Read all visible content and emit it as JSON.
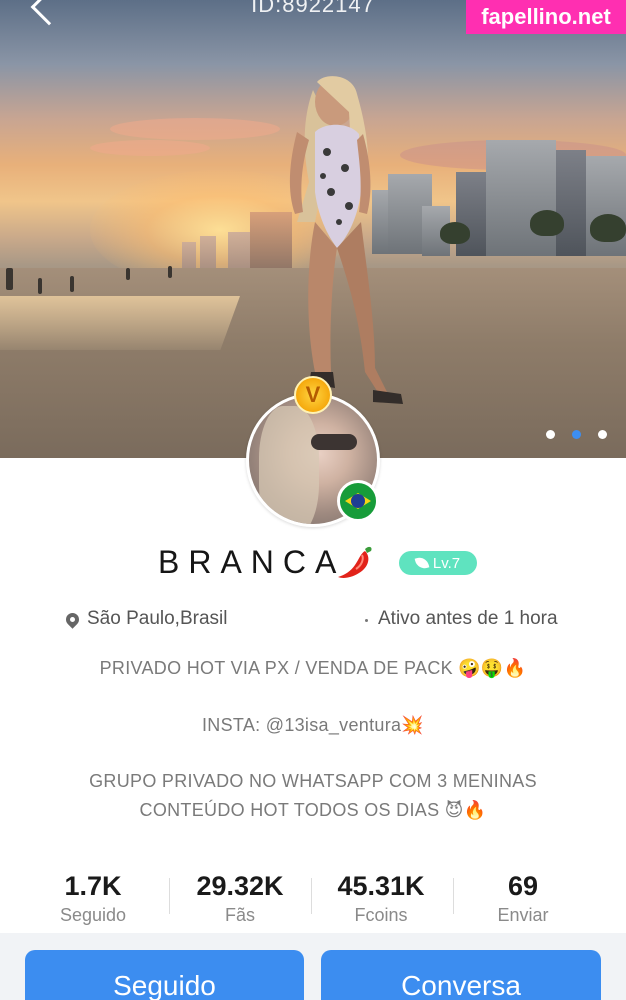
{
  "header": {
    "user_id": "ID:8922147",
    "watermark": "fapellino.net"
  },
  "gallery": {
    "slide_count": 3,
    "active_slide": 2
  },
  "profile": {
    "name": "BRANCA",
    "name_emoji": "chili-pepper",
    "level": "Lv.7",
    "level_color": "#5fe3bf",
    "vip_badge": "V",
    "country_flag": "brazil-flag",
    "location": "São Paulo,Brasil",
    "activity": "Ativo antes de 1 hora",
    "bio": {
      "line1": "PRIVADO HOT VIA PX / VENDA DE PACK 🤪🤑🔥",
      "line2": "INSTA: @13isa_ventura💥",
      "line3": "GRUPO PRIVADO NO WHATSAPP COM 3 MENINAS",
      "line4": "CONTEÚDO HOT TODOS OS DIAS 😈🔥"
    }
  },
  "stats": [
    {
      "value": "1.7K",
      "label": "Seguido"
    },
    {
      "value": "29.32K",
      "label": "Fãs"
    },
    {
      "value": "45.31K",
      "label": "Fcoins"
    },
    {
      "value": "69",
      "label": "Enviar"
    }
  ],
  "actions": {
    "follow_label": "Seguido",
    "chat_label": "Conversa",
    "accent": "#3c8df0"
  }
}
